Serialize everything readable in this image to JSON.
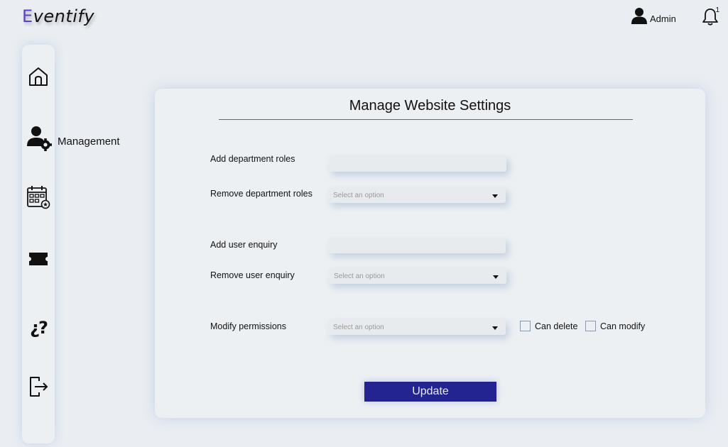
{
  "app": {
    "logo_first_letter": "E",
    "logo_rest": "ventify"
  },
  "header": {
    "user_name": "Admin",
    "notification_count": "1"
  },
  "sidebar": {
    "items": [
      {
        "icon": "home-icon"
      },
      {
        "icon": "user-gear-icon",
        "label": "Management"
      },
      {
        "icon": "calendar-icon"
      },
      {
        "icon": "ticket-icon"
      },
      {
        "icon": "help-icon"
      },
      {
        "icon": "logout-icon"
      }
    ]
  },
  "form": {
    "title": "Manage Website Settings",
    "add_department_roles_label": "Add department roles",
    "remove_department_roles_label": "Remove department roles",
    "remove_department_roles_placeholder": "Select an option",
    "add_user_enquiry_label": "Add user enquiry",
    "remove_user_enquiry_label": "Remove user enquiry",
    "remove_user_enquiry_placeholder": "Select an option",
    "modify_permissions_label": "Modify permissions",
    "modify_permissions_placeholder": "Select an option",
    "can_delete_label": "Can delete",
    "can_modify_label": "Can modify",
    "update_label": "Update"
  },
  "colors": {
    "accent": "#232391",
    "logo_accent": "#5b3fd0",
    "background": "#eaeef2"
  }
}
